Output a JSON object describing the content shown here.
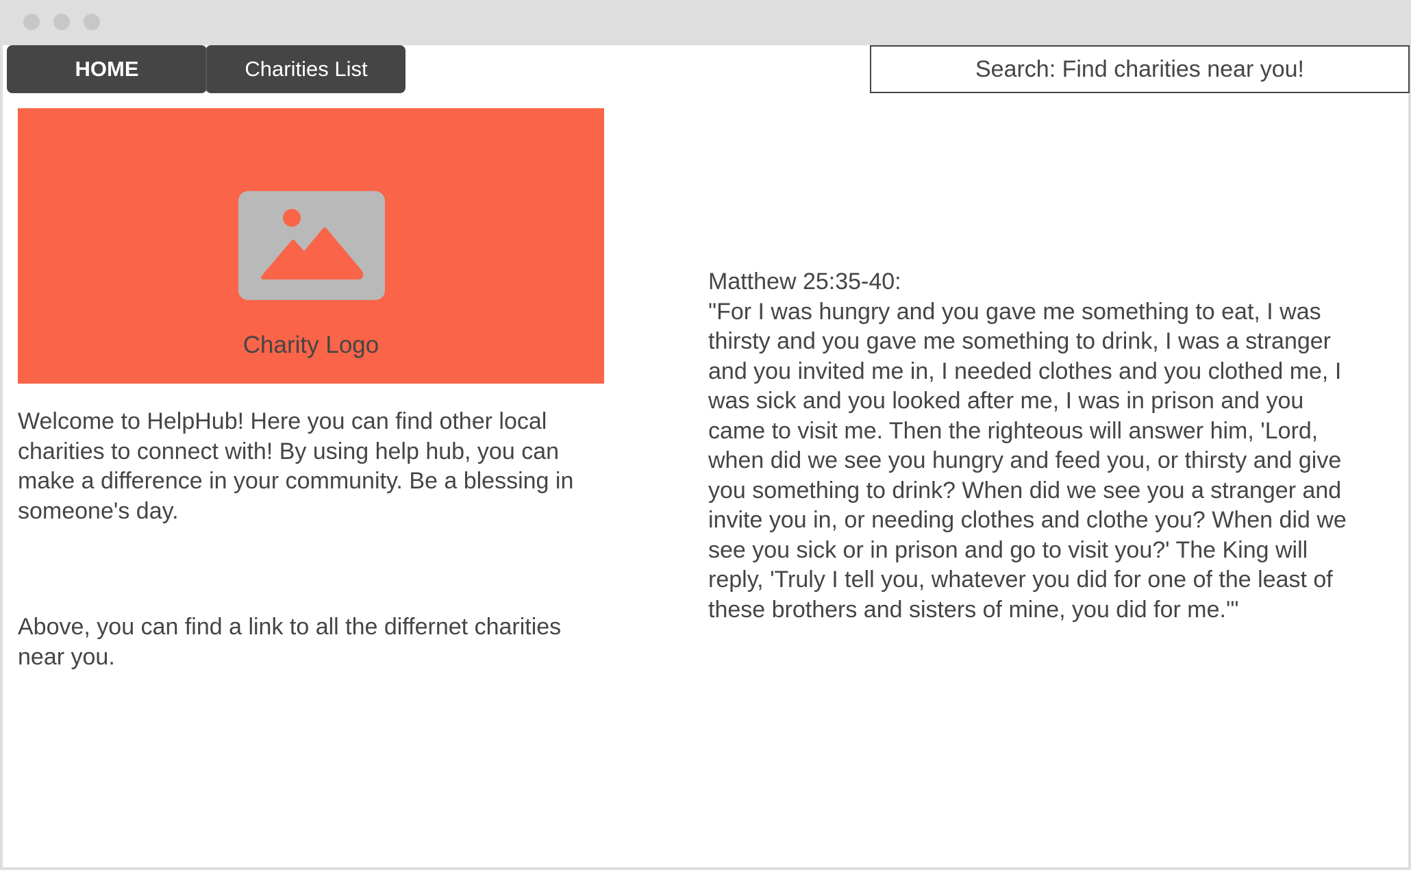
{
  "nav": {
    "home_label": "HOME",
    "charities_label": "Charities List"
  },
  "search": {
    "text": "Search: Find charities near you!"
  },
  "logo": {
    "caption": "Charity Logo",
    "icon": "image-placeholder-icon",
    "background_color": "#fa6448",
    "icon_color": "#b9b9b9"
  },
  "content": {
    "welcome_text": "Welcome to HelpHub! Here you can find other local charities to connect with! By using help hub, you can make a difference in your community. Be a blessing in someone's day.",
    "above_text": "Above, you can find a link to all the differnet charities near you.",
    "verse_title": "Matthew 25:35-40:",
    "verse_text": "\"For I was hungry and you gave me something to eat, I was thirsty and you gave me something to drink, I was a stranger and you invited me in, I needed clothes and you clothed me, I was sick and you looked after me, I was in prison and you came to visit me. Then the righteous will answer him, 'Lord, when did we see you hungry and feed you, or thirsty and give you something to drink? When did we see you a stranger and invite you in, or needing clothes and clothe you? When did we see you sick or in prison and go to visit you?' The King will reply, 'Truly I tell you, whatever you did for one of the least of these brothers and sisters of mine, you did for me.'\""
  },
  "colors": {
    "nav_background": "#454545",
    "text": "#454545",
    "window_chrome": "#dedede"
  }
}
